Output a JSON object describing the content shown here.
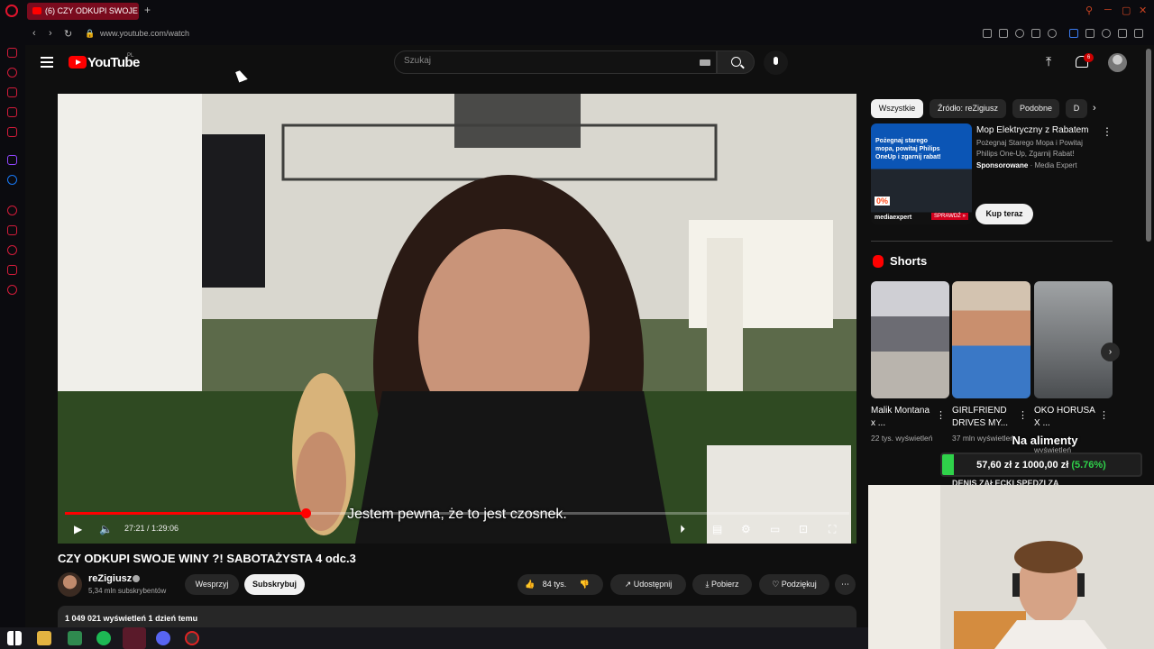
{
  "browser": {
    "tab_title": "(6) CZY ODKUPI SWOJE W",
    "new_tab": "+",
    "url": "www.youtube.com/watch"
  },
  "youtube": {
    "logo_text": "YouTube",
    "country": "PL",
    "search_placeholder": "Szukaj",
    "notification_count": "6"
  },
  "player": {
    "subtitle": "Jestem pewna, że to jest czosnek.",
    "current_time": "27:21",
    "duration": "1:29:06",
    "time_display": "27:21 / 1:29:06",
    "progress_fraction": 0.307
  },
  "video": {
    "title": "CZY ODKUPI SWOJE WINY ?! SABOTAŻYSTA 4 odc.3",
    "channel": "reZigiusz",
    "subscribers": "5,34 mln subskrybentów",
    "support_label": "Wesprzyj",
    "subscribe_label": "Subskrybuj",
    "likes": "84 tys.",
    "share_label": "Udostępnij",
    "download_label": "Pobierz",
    "thanks_label": "Podziękuj",
    "views_date": "1 049 021 wyświetleń  1 dzień temu"
  },
  "chips": [
    "Wszystkie",
    "Źródło: reZigiusz",
    "Podobne",
    "D"
  ],
  "ad": {
    "image_headline": "Pożegnaj starego mopa, powitaj Philips OneUp i zgarnij rabat!",
    "image_badge": "0%",
    "image_logo": "mediaexpert",
    "image_cta": "SPRAWDŹ »",
    "title": "Mop Elektryczny z Rabatem",
    "description": "Pożegnaj Starego Mopa i Powitaj Philips One-Up, Zgarnij Rabat!",
    "sponsored": "Sponsorowane",
    "advertiser": "· Media Expert",
    "buy_label": "Kup teraz"
  },
  "shorts": {
    "heading": "Shorts",
    "items": [
      {
        "title": "Malik Montana x ...",
        "views": "22 tys. wyświetleń"
      },
      {
        "title": "GIRLFRIEND DRIVES MY...",
        "views": "37 mln wyświetleń"
      },
      {
        "title": "OKO HORUSA X ...",
        "views": "wyświetleń"
      }
    ]
  },
  "overlay": {
    "goal_label": "Na alimenty",
    "goal_current": "57,60 zł",
    "goal_sep": " z ",
    "goal_target": "1000,00 zł",
    "goal_percent": "(5.76%)",
    "goal_fraction": 0.0576,
    "next_row_title": "DENIS ZAŁĘCKI SPĘDZI ZA"
  },
  "colors": {
    "accent": "#ff0000",
    "opera": "#e0142d",
    "goal": "#2fd24a"
  }
}
